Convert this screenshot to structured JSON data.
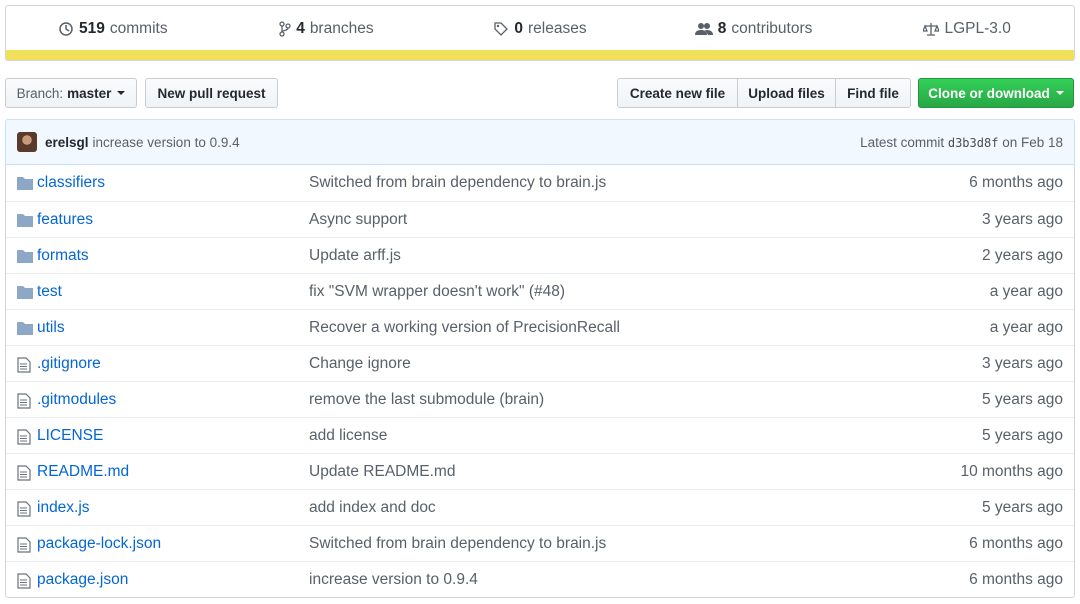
{
  "summary": {
    "commits": {
      "count": "519",
      "label": "commits",
      "icon": "history-icon"
    },
    "branches": {
      "count": "4",
      "label": "branches",
      "icon": "branch-icon"
    },
    "releases": {
      "count": "0",
      "label": "releases",
      "icon": "tag-icon"
    },
    "contributors": {
      "count": "8",
      "label": "contributors",
      "icon": "people-icon"
    },
    "license": {
      "label": "LGPL-3.0",
      "icon": "law-icon"
    },
    "language_color": "#f1e05a"
  },
  "actions": {
    "branch_prefix": "Branch:",
    "branch_name": "master",
    "new_pr": "New pull request",
    "create_file": "Create new file",
    "upload": "Upload files",
    "find": "Find file",
    "clone": "Clone or download"
  },
  "latest_commit": {
    "author": "erelsgl",
    "message": "increase version to 0.9.4",
    "prefix": "Latest commit",
    "sha": "d3b3d8f",
    "date": "on Feb 18"
  },
  "files": [
    {
      "type": "folder",
      "name": "classifiers",
      "message": "Switched from brain dependency to brain.js",
      "age": "6 months ago"
    },
    {
      "type": "folder",
      "name": "features",
      "message": "Async support",
      "age": "3 years ago"
    },
    {
      "type": "folder",
      "name": "formats",
      "message": "Update arff.js",
      "age": "2 years ago"
    },
    {
      "type": "folder",
      "name": "test",
      "message": "fix \"SVM wrapper doesn't work\" (#48)",
      "age": "a year ago"
    },
    {
      "type": "folder",
      "name": "utils",
      "message": "Recover a working version of PrecisionRecall",
      "age": "a year ago"
    },
    {
      "type": "file",
      "name": ".gitignore",
      "message": "Change ignore",
      "age": "3 years ago"
    },
    {
      "type": "file",
      "name": ".gitmodules",
      "message": "remove the last submodule (brain)",
      "age": "5 years ago"
    },
    {
      "type": "file",
      "name": "LICENSE",
      "message": "add license",
      "age": "5 years ago"
    },
    {
      "type": "file",
      "name": "README.md",
      "message": "Update README.md",
      "age": "10 months ago"
    },
    {
      "type": "file",
      "name": "index.js",
      "message": "add index and doc",
      "age": "5 years ago"
    },
    {
      "type": "file",
      "name": "package-lock.json",
      "message": "Switched from brain dependency to brain.js",
      "age": "6 months ago"
    },
    {
      "type": "file",
      "name": "package.json",
      "message": "increase version to 0.9.4",
      "age": "6 months ago"
    }
  ]
}
